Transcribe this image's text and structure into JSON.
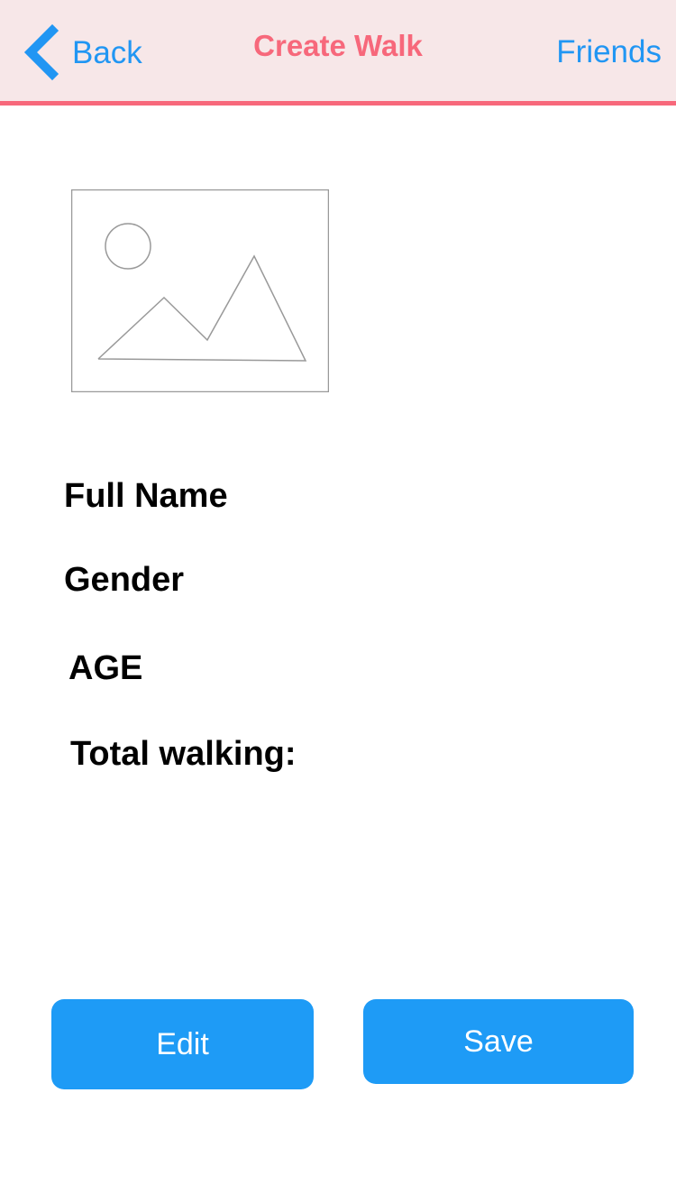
{
  "nav": {
    "back_label": "Back",
    "title": "Create Walk",
    "friends_label": "Friends"
  },
  "profile": {
    "fields": [
      {
        "label": "Full Name"
      },
      {
        "label": "Gender"
      },
      {
        "label": "AGE"
      },
      {
        "label": "Total walking:"
      }
    ]
  },
  "actions": {
    "edit_label": "Edit",
    "save_label": "Save"
  },
  "icons": {
    "back": "chevron-left-icon",
    "photo": "image-placeholder-icon"
  },
  "colors": {
    "accent": "#2196f3",
    "title": "#f7687b",
    "navbar_bg": "#f7e7e8",
    "button_bg": "#1e9bf6"
  }
}
